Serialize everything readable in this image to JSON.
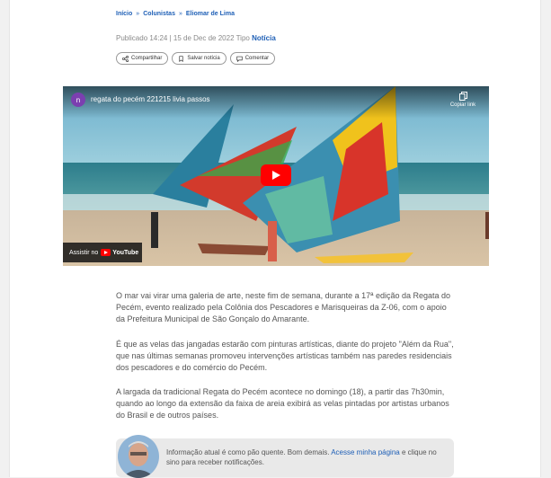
{
  "breadcrumb": {
    "items": [
      "Início",
      "Colunistas",
      "Eliomar de Lima"
    ],
    "separator": "»"
  },
  "meta": {
    "published": "Publicado 14:24 | 15 de Dec de 2022",
    "type_label": "Tipo",
    "type_value": "Notícia"
  },
  "actions": {
    "share": "Compartilhar",
    "save": "Salvar notícia",
    "comment": "Comentar"
  },
  "video": {
    "channel_initial": "n",
    "title": "regata do pecém 221215 livia passos",
    "copy_link": "Copiar link",
    "watch_on": "Assistir no",
    "youtube": "YouTube",
    "icons": [
      "copy-link-icon",
      "play-icon",
      "youtube-logo-icon"
    ]
  },
  "article": {
    "paragraphs": [
      "O mar vai virar uma galeria de arte, neste fim de semana, durante a 17ª edição da Regata do Pecém, evento realizado pela Colônia dos Pescadores e Marisqueiras da Z-06, com o apoio da Prefeitura Municipal de São Gonçalo do Amarante.",
      "É que as velas das jangadas estarão com pinturas artísticas, diante do projeto \"Além da Rua\", que nas últimas semanas promoveu intervenções artísticas também nas paredes residenciais dos pescadores e do comércio do Pecém.",
      "A largada da tradicional Regata do Pecém acontece no domingo (18), a partir das 7h30min, quando ao longo da extensão da faixa de areia exibirá as velas pintadas por artistas urbanos do Brasil e de outros países."
    ]
  },
  "notify": {
    "text_before": "Informação atual é como pão quente. Bom demais. ",
    "link": "Acesse minha página",
    "text_after": " e clique no sino para receber notificações."
  },
  "colors": {
    "link": "#1e5fb6",
    "youtube_red": "#ff0000",
    "channel_avatar": "#7b3fb0"
  }
}
